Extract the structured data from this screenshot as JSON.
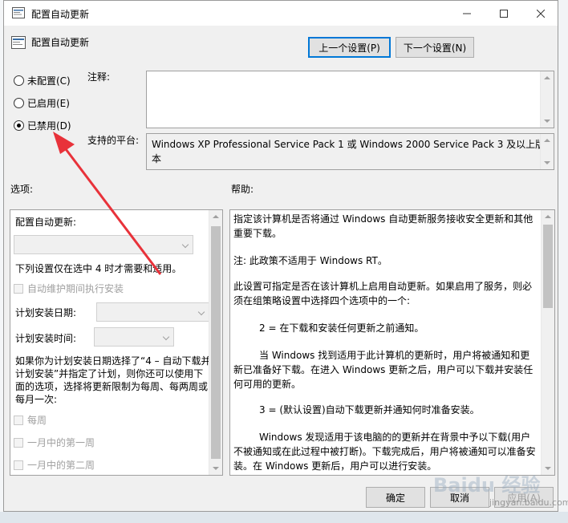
{
  "window": {
    "title": "配置自动更新",
    "header": "配置自动更新"
  },
  "buttons": {
    "prev": "上一个设置(P)",
    "next": "下一个设置(N)",
    "ok": "确定",
    "cancel": "取消",
    "apply": "应用(A)"
  },
  "radios": [
    {
      "label": "未配置(C)",
      "selected": false
    },
    {
      "label": "已启用(E)",
      "selected": false
    },
    {
      "label": "已禁用(D)",
      "selected": true
    }
  ],
  "labels": {
    "comment": "注释:",
    "platform": "支持的平台:",
    "options": "选项:",
    "help": "帮助:"
  },
  "platform_text": "Windows XP Professional Service Pack 1 或 Windows 2000 Service Pack 3 及以上版本",
  "options": {
    "configure_label": "配置自动更新:",
    "note": "下列设置仅在选中 4 时才需要和适用。",
    "maintenance_checkbox": "自动维护期间执行安装",
    "schedule_day": "计划安装日期:",
    "schedule_time": "计划安装时间:",
    "info": "如果你为计划安装日期选择了“4 – 自动下载并计划安装”并指定了计划，则你还可以使用下面的选项，选择将更新限制为每周、每两周或每月一次:",
    "weekly": "每周",
    "first_week": "一月中的第一周",
    "second_week": "一月中的第二周"
  },
  "help_paragraphs": [
    "指定该计算机是否将通过 Windows 自动更新服务接收安全更新和其他重要下载。",
    "注: 此政策不适用于 Windows RT。",
    "此设置可指定是否在该计算机上启用自动更新。如果启用了服务，则必须在组策略设置中选择四个选项中的一个:",
    "2 = 在下载和安装任何更新之前通知。",
    "当 Windows 找到适用于此计算机的更新时，用户将被通知和更新已准备好下载。在进入 Windows 更新之后，用户可以下载并安装任何可用的更新。",
    "3 = (默认设置)自动下载更新并通知何时准备安装。",
    "Windows 发现适用于该电脑的的更新并在背景中予以下载(用户不被通知或在此过程中被打断)。下载完成后，用户将被通知可以准备安装。在 Windows 更新后，用户可以进行安装。"
  ],
  "watermark": {
    "brand": "Baidu 经验",
    "sub": "jingyan.baidu.com"
  },
  "colors": {
    "accent": "#0078d7",
    "arrow": "#e8323a"
  }
}
